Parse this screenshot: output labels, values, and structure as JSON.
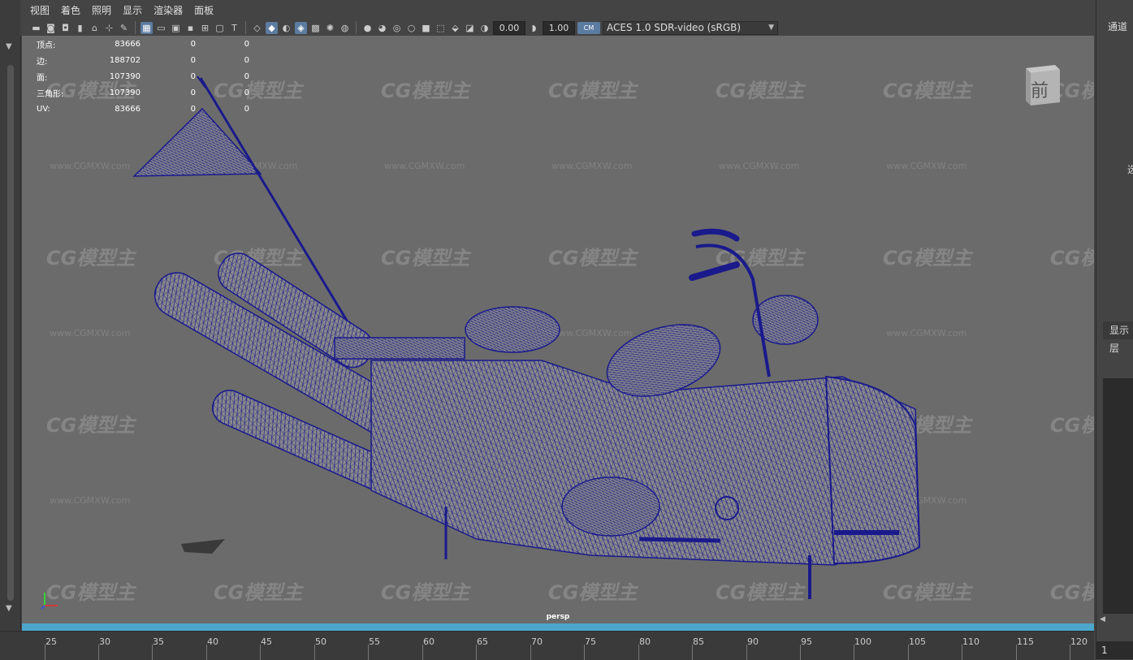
{
  "menu": [
    "视图",
    "着色",
    "照明",
    "显示",
    "渲染器",
    "面板"
  ],
  "toolbar": {
    "exposure": "0.00",
    "gamma": "1.00",
    "color_mgmt_badge": "CM",
    "colorspace": "ACES 1.0 SDR-video (sRGB)"
  },
  "hud": [
    {
      "label": "顶点:",
      "v1": "83666",
      "v2": "0",
      "v3": "0"
    },
    {
      "label": "边:",
      "v1": "188702",
      "v2": "0",
      "v3": "0"
    },
    {
      "label": "面:",
      "v1": "107390",
      "v2": "0",
      "v3": "0"
    },
    {
      "label": "三角形:",
      "v1": "107390",
      "v2": "0",
      "v3": "0"
    },
    {
      "label": "UV:",
      "v1": "83666",
      "v2": "0",
      "v3": "0"
    }
  ],
  "viewport": {
    "camera": "persp",
    "viewcube_face": "前",
    "watermark_logo": "CG模型主",
    "watermark_url": "www.CGMXW.com"
  },
  "timeline": {
    "ticks": [
      "25",
      "30",
      "35",
      "40",
      "45",
      "50",
      "55",
      "60",
      "65",
      "70",
      "75",
      "80",
      "85",
      "90",
      "95",
      "100",
      "105",
      "110",
      "115",
      "120"
    ]
  },
  "right_panel": {
    "channel": "通道",
    "partial": "选",
    "display_tab": "显示",
    "layer": "层",
    "current_frame": "1"
  },
  "colors": {
    "accent": "#5c7ba0",
    "timebar": "#4da6c9",
    "wire": "#1a1a8c"
  }
}
